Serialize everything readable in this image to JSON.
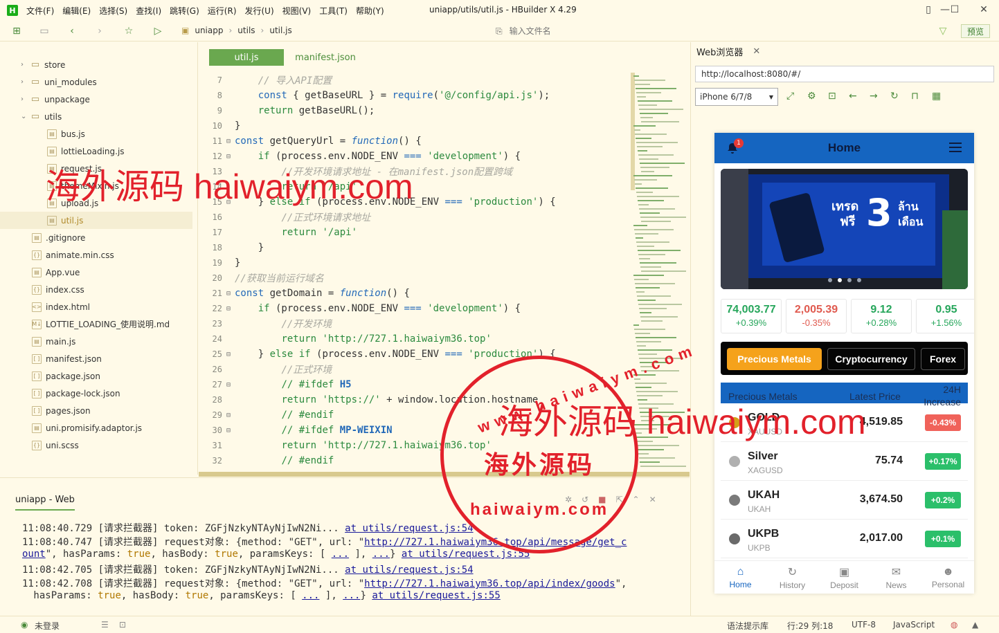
{
  "app": {
    "logo_letter": "H",
    "window_title": "uniapp/utils/util.js - HBuilder X 4.29",
    "menus": [
      "文件(F)",
      "编辑(E)",
      "选择(S)",
      "查找(I)",
      "跳转(G)",
      "运行(R)",
      "发行(U)",
      "视图(V)",
      "工具(T)",
      "帮助(Y)"
    ]
  },
  "toolbar": {
    "breadcrumb": [
      "uniapp",
      "utils",
      "util.js"
    ],
    "file_search_placeholder": "输入文件名",
    "preview_label": "预览"
  },
  "sidebar": {
    "items": [
      {
        "label": "store",
        "kind": "folder",
        "chevron": "›"
      },
      {
        "label": "uni_modules",
        "kind": "folder",
        "chevron": "›"
      },
      {
        "label": "unpackage",
        "kind": "folder",
        "chevron": "›"
      },
      {
        "label": "utils",
        "kind": "folder",
        "chevron": "⌄"
      },
      {
        "label": "bus.js",
        "kind": "file"
      },
      {
        "label": "lottieLoading.js",
        "kind": "file"
      },
      {
        "label": "request.js",
        "kind": "file"
      },
      {
        "label": "themeMixin.js",
        "kind": "file"
      },
      {
        "label": "upload.js",
        "kind": "file"
      },
      {
        "label": "util.js",
        "kind": "file",
        "active": true
      },
      {
        "label": ".gitignore",
        "kind": "file"
      },
      {
        "label": "animate.min.css",
        "kind": "css"
      },
      {
        "label": "App.vue",
        "kind": "file"
      },
      {
        "label": "index.css",
        "kind": "css"
      },
      {
        "label": "index.html",
        "kind": "html"
      },
      {
        "label": "LOTTIE_LOADING_使用说明.md",
        "kind": "md"
      },
      {
        "label": "main.js",
        "kind": "file"
      },
      {
        "label": "manifest.json",
        "kind": "json"
      },
      {
        "label": "package.json",
        "kind": "json"
      },
      {
        "label": "package-lock.json",
        "kind": "json"
      },
      {
        "label": "pages.json",
        "kind": "json"
      },
      {
        "label": "uni.promisify.adaptor.js",
        "kind": "file"
      },
      {
        "label": "uni.scss",
        "kind": "css"
      }
    ]
  },
  "editor": {
    "tabs": [
      "util.js",
      "manifest.json"
    ],
    "lines": [
      {
        "n": "7",
        "tokens": [
          [
            "    ",
            ""
          ],
          [
            "// 导入API配置",
            "cm"
          ]
        ]
      },
      {
        "n": "8",
        "tokens": [
          [
            "    ",
            ""
          ],
          [
            "const",
            "kw"
          ],
          [
            " { getBaseURL } = ",
            ""
          ],
          [
            "require",
            "kw"
          ],
          [
            "(",
            ""
          ],
          [
            "'@/config/api.js'",
            "str"
          ],
          [
            ");",
            ""
          ]
        ]
      },
      {
        "n": "9",
        "tokens": [
          [
            "    ",
            ""
          ],
          [
            "return",
            "str"
          ],
          [
            " getBaseURL();",
            ""
          ]
        ]
      },
      {
        "n": "10",
        "tokens": [
          [
            "}",
            ""
          ]
        ]
      },
      {
        "n": "11",
        "tokens": [
          [
            "const",
            "kw"
          ],
          [
            " getQueryUrl = ",
            ""
          ],
          [
            "function",
            "it"
          ],
          [
            "() {",
            ""
          ]
        ],
        "fold": true
      },
      {
        "n": "12",
        "tokens": [
          [
            "    ",
            ""
          ],
          [
            "if",
            "str"
          ],
          [
            " (process.env.NODE_ENV ",
            ""
          ],
          [
            "===",
            "kw"
          ],
          [
            " ",
            ""
          ],
          [
            "'development'",
            "str"
          ],
          [
            ") {",
            ""
          ]
        ],
        "fold": true
      },
      {
        "n": "13",
        "tokens": [
          [
            "        ",
            ""
          ],
          [
            "//开发环境请求地址 - 在manifest.json配置跨域",
            "cm"
          ]
        ]
      },
      {
        "n": "14",
        "tokens": [
          [
            "        ",
            ""
          ],
          [
            "return",
            "str"
          ],
          [
            " ",
            ""
          ],
          [
            "'/api'",
            "str"
          ]
        ]
      },
      {
        "n": "15",
        "tokens": [
          [
            "    } ",
            ""
          ],
          [
            "else if",
            "str"
          ],
          [
            " (process.env.NODE_ENV ",
            ""
          ],
          [
            "===",
            "kw"
          ],
          [
            " ",
            ""
          ],
          [
            "'production'",
            "str"
          ],
          [
            ") {",
            ""
          ]
        ],
        "fold": true
      },
      {
        "n": "16",
        "tokens": [
          [
            "        ",
            ""
          ],
          [
            "//正式环境请求地址",
            "cm"
          ]
        ]
      },
      {
        "n": "17",
        "tokens": [
          [
            "        ",
            ""
          ],
          [
            "return",
            "str"
          ],
          [
            " ",
            ""
          ],
          [
            "'/api'",
            "str"
          ]
        ]
      },
      {
        "n": "18",
        "tokens": [
          [
            "    }",
            ""
          ]
        ]
      },
      {
        "n": "19",
        "tokens": [
          [
            "}",
            ""
          ]
        ]
      },
      {
        "n": "20",
        "tokens": [
          [
            "//获取当前运行域名",
            "cm"
          ]
        ]
      },
      {
        "n": "21",
        "tokens": [
          [
            "const",
            "kw"
          ],
          [
            " getDomain = ",
            ""
          ],
          [
            "function",
            "it"
          ],
          [
            "() {",
            ""
          ]
        ],
        "fold": true
      },
      {
        "n": "22",
        "tokens": [
          [
            "    ",
            ""
          ],
          [
            "if",
            "str"
          ],
          [
            " (process.env.NODE_ENV ",
            ""
          ],
          [
            "===",
            "kw"
          ],
          [
            " ",
            ""
          ],
          [
            "'development'",
            "str"
          ],
          [
            ") {",
            ""
          ]
        ],
        "fold": true
      },
      {
        "n": "23",
        "tokens": [
          [
            "        ",
            ""
          ],
          [
            "//开发环境",
            "cm"
          ]
        ]
      },
      {
        "n": "24",
        "tokens": [
          [
            "        ",
            ""
          ],
          [
            "return",
            "str"
          ],
          [
            " ",
            ""
          ],
          [
            "'http://727.1.haiwaiym36.top'",
            "str"
          ]
        ]
      },
      {
        "n": "25",
        "tokens": [
          [
            "    } ",
            ""
          ],
          [
            "else if",
            "str"
          ],
          [
            " (process.env.NODE_ENV ",
            ""
          ],
          [
            "===",
            "kw"
          ],
          [
            " ",
            ""
          ],
          [
            "'production'",
            "str"
          ],
          [
            ") {",
            ""
          ]
        ],
        "fold": true
      },
      {
        "n": "26",
        "tokens": [
          [
            "        ",
            ""
          ],
          [
            "//正式环境",
            "cm"
          ]
        ]
      },
      {
        "n": "27",
        "tokens": [
          [
            "        ",
            ""
          ],
          [
            "// #ifdef ",
            "str"
          ],
          [
            "H5",
            "pp"
          ]
        ],
        "fold": true
      },
      {
        "n": "28",
        "tokens": [
          [
            "        ",
            ""
          ],
          [
            "return",
            "str"
          ],
          [
            " ",
            ""
          ],
          [
            "'https://'",
            "str"
          ],
          [
            " + window.location.hostname",
            ""
          ]
        ]
      },
      {
        "n": "29",
        "tokens": [
          [
            "        ",
            ""
          ],
          [
            "// #endif",
            "str"
          ]
        ],
        "fold": true
      },
      {
        "n": "30",
        "tokens": [
          [
            "        ",
            ""
          ],
          [
            "// #ifdef ",
            "str"
          ],
          [
            "MP-WEIXIN",
            "pp"
          ]
        ],
        "fold": true
      },
      {
        "n": "31",
        "tokens": [
          [
            "        ",
            ""
          ],
          [
            "return",
            "str"
          ],
          [
            " ",
            ""
          ],
          [
            "'http://727.1.haiwaiym36.top'",
            "str"
          ]
        ]
      },
      {
        "n": "32",
        "tokens": [
          [
            "        ",
            ""
          ],
          [
            "// #endif",
            "str"
          ]
        ]
      }
    ]
  },
  "console": {
    "tab_label": "uniapp - Web",
    "lines": [
      [
        [
          "11:08:40.729 [请求拦截器] token: ZGFjNzkyNTAyNjIwN2Ni... ",
          ""
        ],
        [
          "at utils/request.js:54",
          "a"
        ]
      ],
      [
        [
          "11:08:40.747 [请求拦截器] request对象: {method: \"GET\", url: \"",
          ""
        ],
        [
          "http://727.1.haiwaiym36.top/api/message/get_c",
          "a"
        ]
      ],
      [
        [
          "ount",
          "a"
        ],
        [
          "\", hasParams: ",
          ""
        ],
        [
          "true",
          "b"
        ],
        [
          ", hasBody: ",
          ""
        ],
        [
          "true",
          "b"
        ],
        [
          ", paramsKeys: [ ",
          ""
        ],
        [
          "...",
          "a"
        ],
        [
          " ], ",
          ""
        ],
        [
          "...",
          "a"
        ],
        [
          "} ",
          ""
        ],
        [
          "at utils/request.js:55",
          "a"
        ]
      ],
      [
        [
          "11:08:42.705 [请求拦截器] token: ZGFjNzkyNTAyNjIwN2Ni... ",
          ""
        ],
        [
          "at utils/request.js:54",
          "a"
        ]
      ],
      [
        [
          "11:08:42.708 [请求拦截器] request对象: {method: \"GET\", url: \"",
          ""
        ],
        [
          "http://727.1.haiwaiym36.top/api/index/goods",
          "a"
        ],
        [
          "\",",
          ""
        ]
      ],
      [
        [
          " hasParams: ",
          ""
        ],
        [
          "true",
          "b"
        ],
        [
          ", hasBody: ",
          ""
        ],
        [
          "true",
          "b"
        ],
        [
          ", paramsKeys: [ ",
          ""
        ],
        [
          "...",
          "a"
        ],
        [
          " ], ",
          ""
        ],
        [
          "...",
          "a"
        ],
        [
          "} ",
          ""
        ],
        [
          "at utils/request.js:55",
          "a"
        ]
      ]
    ]
  },
  "statusbar": {
    "login": "未登录",
    "hint_lib": "语法提示库",
    "position": "行:29  列:18",
    "encoding": "UTF-8",
    "language": "JavaScript"
  },
  "browser": {
    "tab_label": "Web浏览器",
    "url": "http://localhost:8080/#/",
    "device": "iPhone 6/7/8"
  },
  "phone": {
    "title": "Home",
    "badge": "1",
    "banner_text": {
      "line1": "เทรด",
      "line2": "ฟรี",
      "num": "3",
      "line3": "ล้าน",
      "line4": "เดือน"
    },
    "tickers": [
      {
        "value": "74,003.77",
        "change": "+0.39%",
        "dir": "up"
      },
      {
        "value": "2,005.39",
        "change": "-0.35%",
        "dir": "down"
      },
      {
        "value": "9.12",
        "change": "+0.28%",
        "dir": "up"
      },
      {
        "value": "0.95",
        "change": "+1.56%",
        "dir": "up"
      }
    ],
    "segments": [
      "Precious Metals",
      "Cryptocurrency",
      "Forex"
    ],
    "table_head": {
      "name": "Precious Metals",
      "price": "Latest Price",
      "change_line1": "24H",
      "change_line2": "Increase"
    },
    "rows": [
      {
        "name": "GOLD",
        "symbol": "XAUUSD",
        "price": "4,519.85",
        "change": "-0.43%",
        "dir": "down",
        "icon": "#d4a017"
      },
      {
        "name": "Silver",
        "symbol": "XAGUSD",
        "price": "75.74",
        "change": "+0.17%",
        "dir": "up",
        "icon": "#b0b0b0"
      },
      {
        "name": "UKAH",
        "symbol": "UKAH",
        "price": "3,674.50",
        "change": "+0.2%",
        "dir": "up",
        "icon": "#7a7a7a"
      },
      {
        "name": "UKPB",
        "symbol": "UKPB",
        "price": "2,017.00",
        "change": "+0.1%",
        "dir": "up",
        "icon": "#6a6a6a"
      }
    ],
    "tabs": [
      {
        "label": "Home",
        "icon": "home-icon",
        "glyph": "⌂"
      },
      {
        "label": "History",
        "icon": "history-icon",
        "glyph": "↻"
      },
      {
        "label": "Deposit",
        "icon": "wallet-icon",
        "glyph": "▣"
      },
      {
        "label": "News",
        "icon": "chat-icon",
        "glyph": "✉"
      },
      {
        "label": "Personal",
        "icon": "user-icon",
        "glyph": "☻"
      }
    ]
  },
  "watermark": {
    "text1": "海外源码 haiwaiym.com",
    "stamp_top": "www.haiwaiym.com",
    "stamp_middle": "海外源码",
    "stamp_bottom": "haiwaiym.com",
    "text2": "海外源码 haiwaiym.com"
  }
}
